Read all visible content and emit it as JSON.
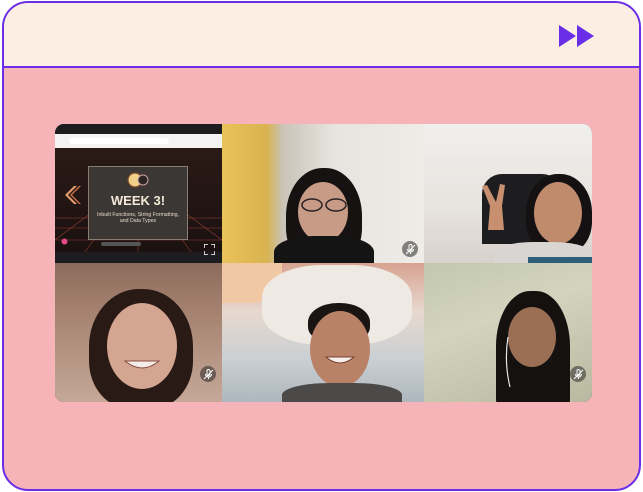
{
  "header": {
    "fast_forward_icon": "fast-forward-icon",
    "accent": "#6a2ee8",
    "bar_color": "#fdeee3"
  },
  "page": {
    "background": "#f6b3b8"
  },
  "screen_share": {
    "slide_title": "WEEK 3!",
    "slide_subtitle": "Inbuilt Functions, String Formatting, and Data Types"
  },
  "participants": [
    {
      "tile": "screen-share",
      "muted": false
    },
    {
      "tile": "participant-2",
      "muted": true
    },
    {
      "tile": "participant-3",
      "muted": false
    },
    {
      "tile": "participant-4",
      "muted": true
    },
    {
      "tile": "participant-5",
      "muted": false
    },
    {
      "tile": "participant-6",
      "muted": true
    }
  ],
  "icons": {
    "mute": "mic-off-icon",
    "expand": "fullscreen-icon"
  }
}
